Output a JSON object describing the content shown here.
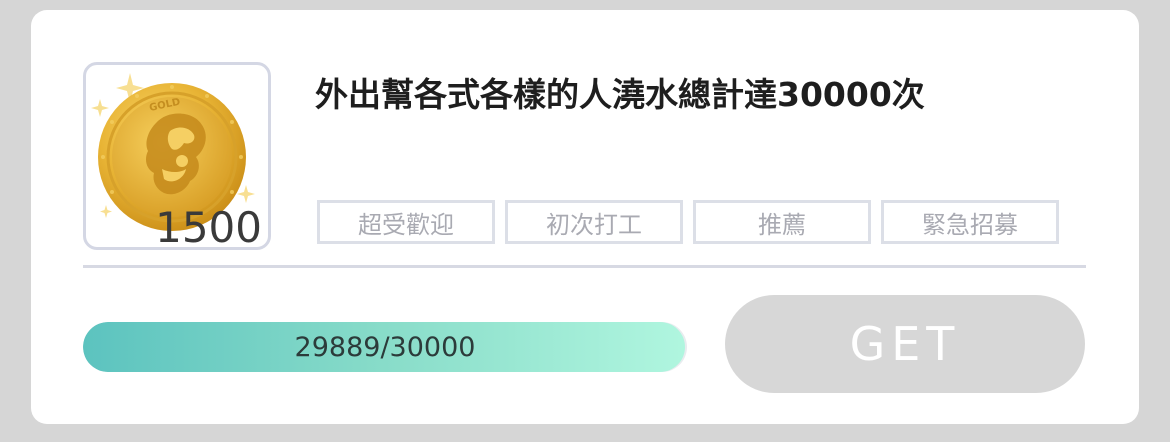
{
  "quest": {
    "title": "外出幫各式各樣的人澆水總計達30000次",
    "reward": {
      "amount": "1500",
      "icon": "gold-coin-icon",
      "coin_engraving": "GOLD"
    },
    "tags": [
      {
        "label": "超受歡迎"
      },
      {
        "label": "初次打工"
      },
      {
        "label": "推薦"
      },
      {
        "label": "緊急招募"
      }
    ],
    "progress": {
      "text": "29889/30000",
      "current": 29889,
      "total": 30000,
      "fraction": 0.9963
    },
    "get_button": {
      "label": "GET",
      "enabled": false
    }
  },
  "colors": {
    "page_background": "#d6d6d6",
    "card_background": "#ffffff",
    "progress_start": "#5cc3bf",
    "progress_end": "#b0f6df",
    "button_disabled": "#d7d7d7",
    "tag_border": "#dcdfe7",
    "tag_text": "#a9aab2"
  }
}
